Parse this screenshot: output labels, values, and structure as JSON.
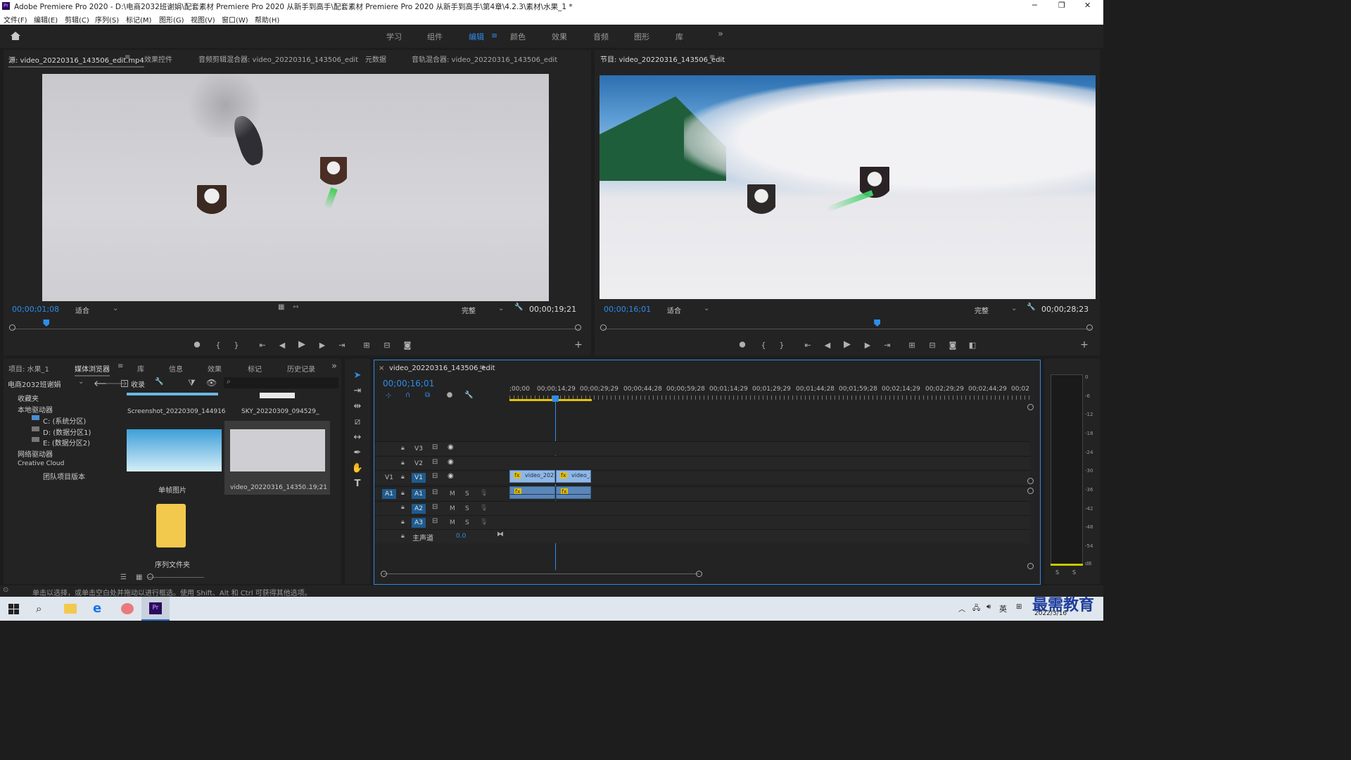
{
  "app": {
    "title": "Adobe Premiere Pro 2020 - D:\\电商2032班谢娟\\配套素材 Premiere Pro 2020 从新手到高手\\配套素材 Premiere Pro 2020 从新手到高手\\第4章\\4.2.3\\素材\\水果_1 *",
    "minimize": "─",
    "maximize": "❐",
    "close": "✕"
  },
  "menu": [
    "文件(F)",
    "编辑(E)",
    "剪辑(C)",
    "序列(S)",
    "标记(M)",
    "图形(G)",
    "视图(V)",
    "窗口(W)",
    "帮助(H)"
  ],
  "workspaces": [
    "学习",
    "组件",
    "编辑",
    "颜色",
    "效果",
    "音频",
    "图形",
    "库"
  ],
  "workspace_active": "编辑",
  "workspace_more": "»",
  "source_panel": {
    "tabs": [
      "源: video_20220316_143506_edit.mp4",
      "效果控件",
      "音频剪辑混合器: video_20220316_143506_edit",
      "元数据",
      "音轨混合器: video_20220316_143506_edit"
    ],
    "timecode": "00;00;01;08",
    "fit": "适合",
    "quality": "完整",
    "duration": "00;00;19;21",
    "playhead_fraction": 0.06
  },
  "program_panel": {
    "tab": "节目: video_20220316_143506_edit",
    "timecode": "00;00;16;01",
    "fit": "适合",
    "quality": "完整",
    "duration": "00;00;28;23",
    "playhead_fraction": 0.56
  },
  "project_panel": {
    "tabs": [
      "项目: 水果_1",
      "媒体浏览器",
      "库",
      "信息",
      "效果",
      "标记",
      "历史记录"
    ],
    "location": "电商2032班谢娟",
    "ingest_label": "收录",
    "tree": [
      "收藏夹",
      "本地驱动器",
      "C: (系统分区)",
      "D: (数据分区1)",
      "E: (数据分区2)",
      "网络驱动器",
      "Creative Cloud",
      "团队项目版本"
    ],
    "thumbs": [
      {
        "name": "Screenshot_20220309_144916",
        "dur": ""
      },
      {
        "name": "SKY_20220309_094529_",
        "dur": ""
      },
      {
        "name": "单帧图片",
        "dur": ""
      },
      {
        "name": "video_20220316_14350...",
        "dur": "19;21"
      },
      {
        "name": "序列文件夹",
        "dur": ""
      }
    ]
  },
  "timeline": {
    "sequence": "video_20220316_143506_edit",
    "timecode": "00;00;16;01",
    "ruler": [
      ";00;00",
      "00;00;14;29",
      "00;00;29;29",
      "00;00;44;28",
      "00;00;59;28",
      "00;01;14;29",
      "00;01;29;29",
      "00;01;44;28",
      "00;01;59;28",
      "00;02;14;29",
      "00;02;29;29",
      "00;02;44;29",
      "00;02"
    ],
    "video_tracks": [
      "V3",
      "V2",
      "V1"
    ],
    "audio_tracks": [
      "A1",
      "A2",
      "A3"
    ],
    "master_label": "主声道",
    "master_value": "0.0",
    "clip1": "video_2022",
    "clip2": "video_2",
    "fx": "fx",
    "m": "M",
    "s": "S"
  },
  "meter": {
    "scale": [
      "0",
      "-6",
      "-12",
      "-18",
      "-24",
      "-30",
      "-36",
      "-42",
      "-48",
      "-54",
      "dB"
    ],
    "solo": [
      "S",
      "S"
    ]
  },
  "status": "单击以选择，或单击空白处并拖动以进行框选。使用 Shift、Alt 和 Ctrl 可获得其他选项。",
  "taskbar": {
    "ime": "英",
    "date": "2022/3/16",
    "watermark": "最需教育"
  },
  "colors": {
    "accent": "#2d8ceb",
    "panel": "#232323",
    "bg": "#1d1d1d",
    "clip": "#8fb7e6"
  }
}
